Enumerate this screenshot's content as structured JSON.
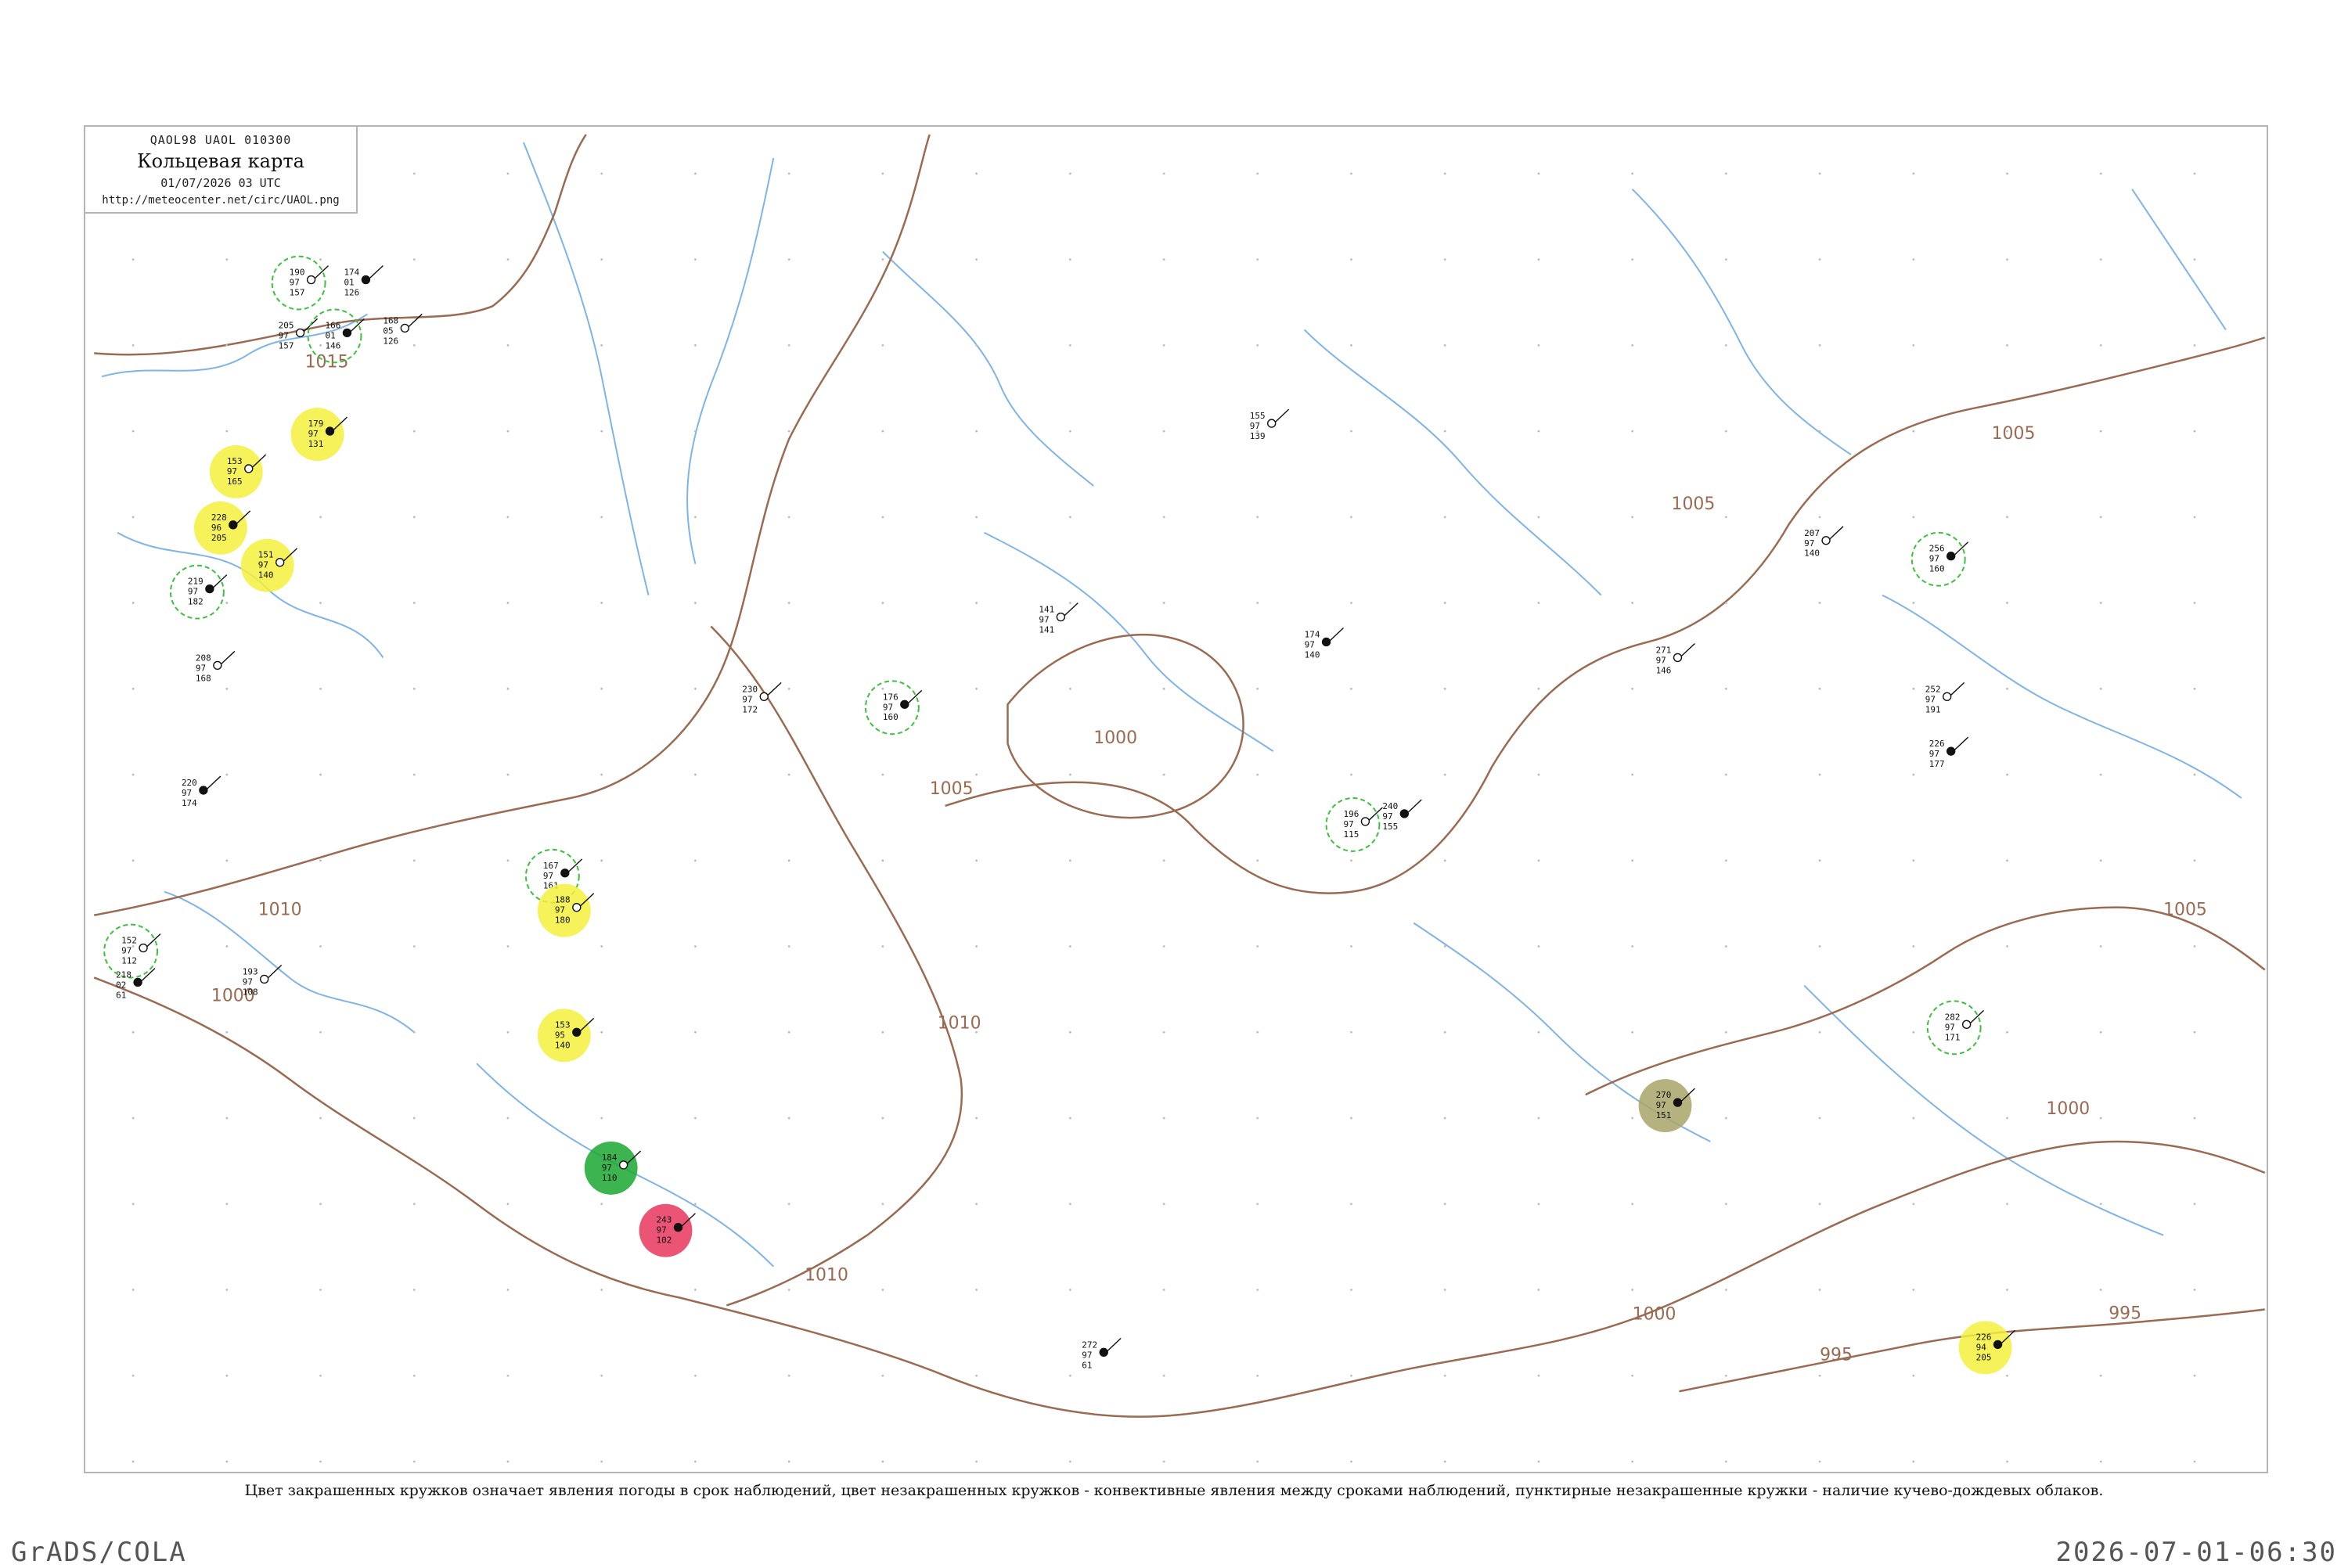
{
  "legend": {
    "line1": "QAOL98  UAOL  010300",
    "title": "Кольцевая карта",
    "date": "01/07/2026 03 UTC",
    "url": "http://meteocenter.net/circ/UAOL.png"
  },
  "caption": "Цвет закрашенных кружков означает явления погоды в срок наблюдений, цвет незакрашенных кружков - конвективные явления между сроками наблюдений, пунктирные незакрашенные кружки - наличие кучево-дождевых облаков.",
  "footer": {
    "left": "GrADS/COLA",
    "right": "2026-07-01-06:30"
  },
  "colors": {
    "isobar": "#9a6b52",
    "river": "#7fb4e8",
    "cb_circle": "#3cc13c",
    "rain_fill": "#1aa832",
    "fog_fill": "#f5f03c",
    "thunder_fill": "#e8365c",
    "shower_fill": "#4fe08a",
    "haze_fill": "#a9a46a"
  },
  "isobar_labels": [
    "1015",
    "1010",
    "1005",
    "1000",
    "995"
  ],
  "stations": [
    {
      "t": "190",
      "p": "97",
      "d": "157"
    },
    {
      "t": "174",
      "p": "01",
      "d": "126"
    },
    {
      "t": "205",
      "p": "97",
      "d": "157"
    },
    {
      "t": "166",
      "p": "01",
      "d": "146"
    },
    {
      "t": "168",
      "p": "05",
      "d": "126"
    },
    {
      "t": "179",
      "p": "97",
      "d": "131"
    },
    {
      "t": "153",
      "p": "97",
      "d": "165"
    },
    {
      "t": "228",
      "p": "96",
      "d": "205"
    },
    {
      "t": "151",
      "p": "97",
      "d": "140"
    },
    {
      "t": "219",
      "p": "97",
      "d": "182"
    },
    {
      "t": "208",
      "p": "97",
      "d": "168"
    },
    {
      "t": "220",
      "p": "97",
      "d": "174"
    },
    {
      "t": "152",
      "p": "97",
      "d": "112"
    },
    {
      "t": "218",
      "p": "02",
      "d": "61"
    },
    {
      "t": "193",
      "p": "97",
      "d": "108"
    },
    {
      "t": "167",
      "p": "97",
      "d": "161"
    },
    {
      "t": "188",
      "p": "97",
      "d": "180"
    },
    {
      "t": "153",
      "p": "95",
      "d": "140"
    },
    {
      "t": "184",
      "p": "97",
      "d": "110"
    },
    {
      "t": "243",
      "p": "97",
      "d": "102"
    },
    {
      "t": "230",
      "p": "97",
      "d": "172"
    },
    {
      "t": "176",
      "p": "97",
      "d": "160"
    },
    {
      "t": "141",
      "p": "97",
      "d": "141"
    },
    {
      "t": "174",
      "p": "97",
      "d": "140"
    },
    {
      "t": "196",
      "p": "97",
      "d": "115"
    },
    {
      "t": "240",
      "p": "97",
      "d": "155"
    },
    {
      "t": "271",
      "p": "97",
      "d": "146"
    },
    {
      "t": "256",
      "p": "97",
      "d": "160"
    },
    {
      "t": "252",
      "p": "97",
      "d": "191"
    },
    {
      "t": "226",
      "p": "97",
      "d": "177"
    },
    {
      "t": "282",
      "p": "97",
      "d": "171"
    },
    {
      "t": "226",
      "p": "94",
      "d": "205"
    },
    {
      "t": "207",
      "p": "97",
      "d": "140"
    },
    {
      "t": "270",
      "p": "97",
      "d": "151"
    },
    {
      "t": "155",
      "p": "97",
      "d": "139"
    },
    {
      "t": "272",
      "p": "97",
      "d": "61"
    }
  ]
}
